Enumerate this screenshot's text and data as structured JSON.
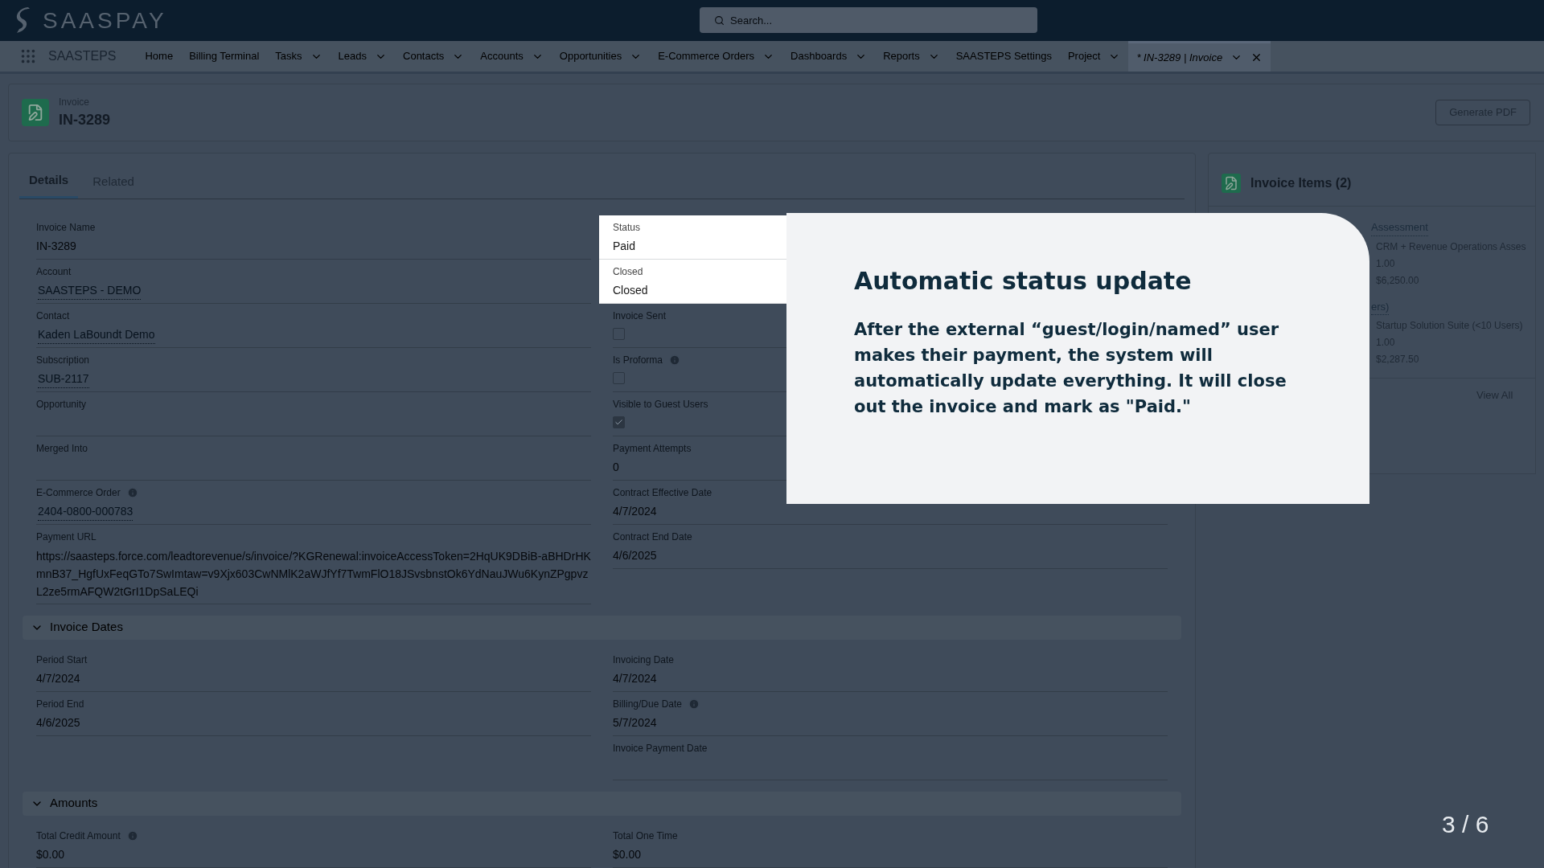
{
  "app": {
    "logo": "SAASPAY",
    "search_placeholder": "Search..."
  },
  "nav": {
    "app_name": "SAASTEPS",
    "items": [
      {
        "label": "Home",
        "has_menu": false,
        "selected": false,
        "closable": false
      },
      {
        "label": "Billing Terminal",
        "has_menu": false,
        "selected": false,
        "closable": false
      },
      {
        "label": "Tasks",
        "has_menu": true,
        "selected": false,
        "closable": false
      },
      {
        "label": "Leads",
        "has_menu": true,
        "selected": false,
        "closable": false
      },
      {
        "label": "Contacts",
        "has_menu": true,
        "selected": false,
        "closable": false
      },
      {
        "label": "Accounts",
        "has_menu": true,
        "selected": false,
        "closable": false
      },
      {
        "label": "Opportunities",
        "has_menu": true,
        "selected": false,
        "closable": false
      },
      {
        "label": "E-Commerce Orders",
        "has_menu": true,
        "selected": false,
        "closable": false
      },
      {
        "label": "Dashboards",
        "has_menu": true,
        "selected": false,
        "closable": false
      },
      {
        "label": "Reports",
        "has_menu": true,
        "selected": false,
        "closable": false
      },
      {
        "label": "SAASTEPS Settings",
        "has_menu": false,
        "selected": false,
        "closable": false
      },
      {
        "label": "Project",
        "has_menu": true,
        "selected": false,
        "closable": false
      },
      {
        "label": "* IN-3289 | Invoice",
        "has_menu": true,
        "selected": true,
        "closable": true
      }
    ]
  },
  "record": {
    "type": "Invoice",
    "name": "IN-3289",
    "actions": [
      "Generate PDF"
    ]
  },
  "tabs": [
    {
      "label": "Details",
      "selected": true
    },
    {
      "label": "Related",
      "selected": false
    }
  ],
  "details": {
    "rows": [
      [
        {
          "label": "Invoice Name",
          "kind": "text",
          "value": "IN-3289",
          "info": false,
          "spotlight": false
        },
        {
          "label": "Status",
          "kind": "text",
          "value": "Paid",
          "info": false,
          "spotlight": true
        }
      ],
      [
        {
          "label": "Account",
          "kind": "link",
          "value": "SAASTEPS - DEMO",
          "info": false,
          "spotlight": false
        },
        {
          "label": "Closed",
          "kind": "text",
          "value": "Closed",
          "info": false,
          "spotlight": true
        }
      ],
      [
        {
          "label": "Contact",
          "kind": "link",
          "value": "Kaden LaBoundt Demo",
          "info": false,
          "spotlight": false
        },
        {
          "label": "Invoice Sent",
          "kind": "checkbox",
          "checked": false,
          "info": false,
          "spotlight": false
        }
      ],
      [
        {
          "label": "Subscription",
          "kind": "link",
          "value": "SUB-2117",
          "info": false,
          "spotlight": false
        },
        {
          "label": "Is Proforma",
          "kind": "checkbox",
          "checked": false,
          "info": true,
          "spotlight": false
        }
      ],
      [
        {
          "label": "Opportunity",
          "kind": "text",
          "info": false,
          "spotlight": false
        },
        {
          "label": "Visible to Guest Users",
          "kind": "checkbox",
          "checked": true,
          "info": false,
          "spotlight": false
        }
      ],
      [
        {
          "label": "Merged Into",
          "kind": "text",
          "info": false,
          "spotlight": false
        },
        {
          "label": "Payment Attempts",
          "kind": "text",
          "value": "0",
          "info": false,
          "spotlight": false
        }
      ],
      [
        {
          "label": "E-Commerce Order",
          "kind": "link",
          "value": "2404-0800-000783",
          "info": true,
          "spotlight": false
        },
        {
          "label": "Contract Effective Date",
          "kind": "text",
          "value": "4/7/2024",
          "info": false,
          "spotlight": false
        }
      ],
      [
        {
          "label": "Payment URL",
          "kind": "url",
          "value": "https://saasteps.force.com/leadtorevenue/s/invoice/?KGRenewal:invoiceAccessToken=2HqUK9DBiB-aBHDrHKmnB37_HgfUxFeqGTo7SwImtaw=v9Xjx603CwNMlK2aWJfYf7TwmFlO18JSvsbnstOk6YdNauJWu6KynZPgpvzL2ze5rmAFQW2tGrI1DpSaLEQi",
          "info": false,
          "spotlight": false
        },
        {
          "label": "Contract End Date",
          "kind": "text",
          "value": "4/6/2025",
          "info": false,
          "spotlight": false
        }
      ]
    ]
  },
  "sections": [
    {
      "title": "Invoice Dates",
      "expanded": true,
      "rows": [
        [
          {
            "label": "Period Start",
            "kind": "text",
            "value": "4/7/2024",
            "info": false,
            "spotlight": false
          },
          {
            "label": "Invoicing Date",
            "kind": "text",
            "value": "4/7/2024",
            "info": false,
            "spotlight": false
          }
        ],
        [
          {
            "label": "Period End",
            "kind": "text",
            "value": "4/6/2025",
            "info": false,
            "spotlight": false
          },
          {
            "label": "Billing/Due Date",
            "kind": "text",
            "value": "5/7/2024",
            "info": true,
            "spotlight": false
          }
        ],
        [
          {
            "kind": "blank"
          },
          {
            "label": "Invoice Payment Date",
            "kind": "text",
            "info": false,
            "spotlight": false
          }
        ]
      ]
    },
    {
      "title": "Amounts",
      "expanded": true,
      "rows": [
        [
          {
            "label": "Total Credit Amount",
            "kind": "text",
            "value": "$0.00",
            "info": true,
            "spotlight": false
          },
          {
            "label": "Total One Time",
            "kind": "text",
            "value": "$0.00",
            "info": false,
            "spotlight": false
          }
        ]
      ]
    }
  ],
  "related": {
    "title": "Invoice Items (2)",
    "items": [
      {
        "title": "Assessment",
        "lines": [
          "CRM + Revenue Operations Asses",
          "1.00",
          "$6,250.00"
        ]
      },
      {
        "title": "ers)",
        "lines": [
          "Startup Solution Suite (<10 Users)",
          "1.00",
          "$2,287.50"
        ]
      }
    ],
    "view_all": "View All"
  },
  "tour": {
    "title": "Automatic status update",
    "body": "After the external “guest/login/named” user makes their payment, the system will automatically update everything. It will close out the invoice and mark as \"Paid.\"",
    "step": "3 / 6"
  }
}
